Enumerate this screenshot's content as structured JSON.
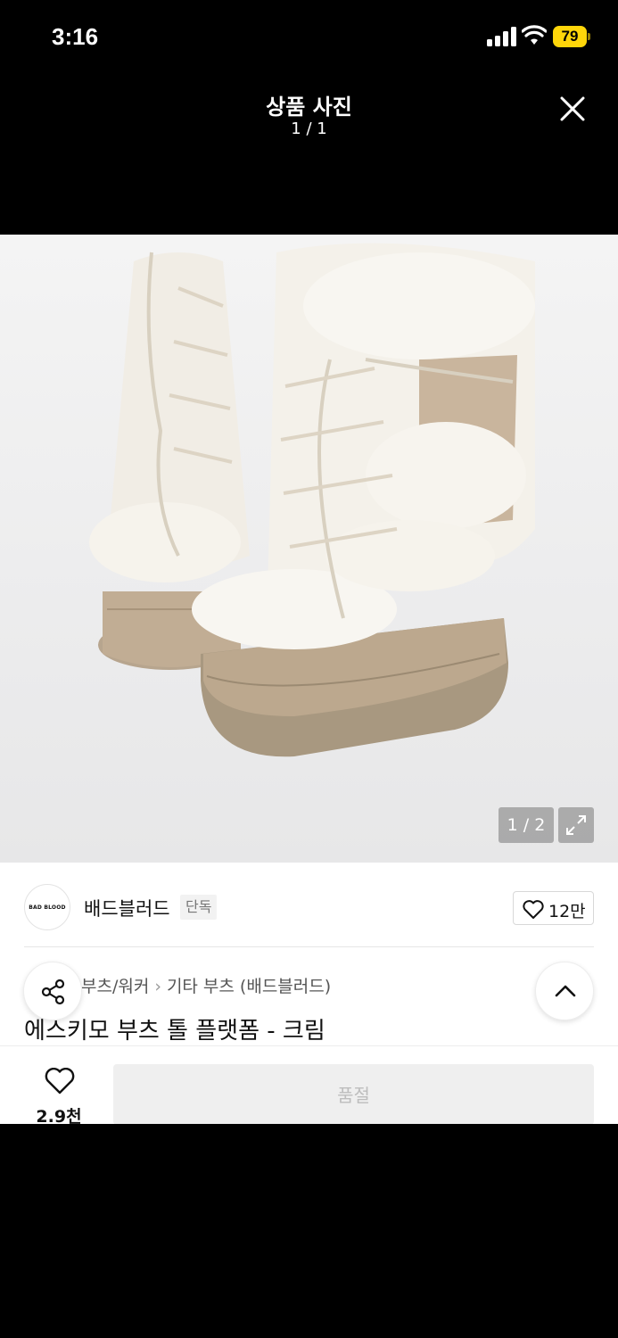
{
  "status_bar": {
    "time": "3:16",
    "battery": "79"
  },
  "viewer": {
    "title": "상품 사진",
    "count": "1 / 1"
  },
  "photo": {
    "counter": "1 / 2"
  },
  "brand": {
    "logo_text": "BAD BLOOD",
    "name": "배드블러드",
    "badge": "단독",
    "likes": "12만"
  },
  "breadcrumb": [
    "부츠/워커",
    "기타 부츠 (배드블러드)"
  ],
  "product": {
    "title": "에스키모 부츠 톨 플랫폼 - 크림"
  },
  "bottom_bar": {
    "like_count": "2.9천",
    "buy_label": "품절"
  },
  "colors": {
    "background": "#000000",
    "battery": "#ffd60a",
    "soldout_bg": "#efefef",
    "soldout_text": "#bdbdbd"
  },
  "icons": [
    "signal-icon",
    "wifi-icon",
    "close-icon",
    "expand-icon",
    "heart-icon",
    "share-icon",
    "chevron-up-icon"
  ]
}
